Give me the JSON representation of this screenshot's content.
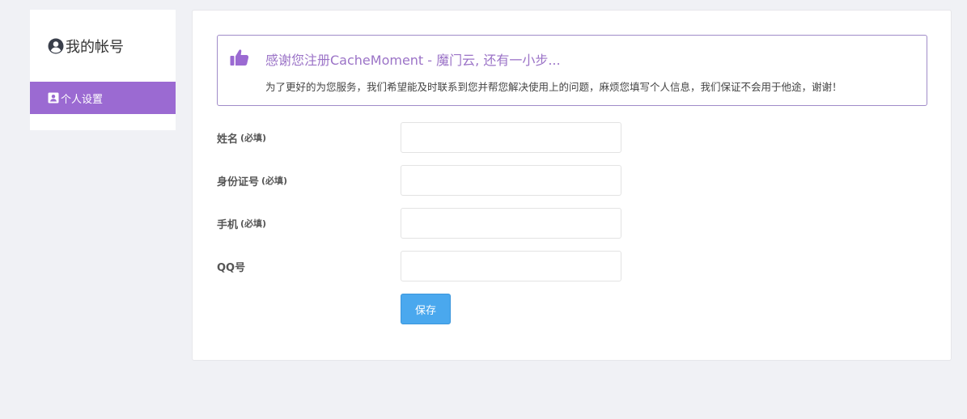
{
  "sidebar": {
    "title": "我的帐号",
    "title_icon": "user-circle-icon",
    "items": [
      {
        "label": "个人设置",
        "icon": "user-card-icon",
        "active": true
      }
    ]
  },
  "notice": {
    "icon": "thumbs-up-icon",
    "title": "感谢您注册CacheMoment - 魔门云, 还有一小步...",
    "description": "为了更好的为您服务，我们希望能及时联系到您并帮您解决使用上的问题，麻烦您填写个人信息，我们保证不会用于他途，谢谢！"
  },
  "form": {
    "fields": [
      {
        "label": "姓名",
        "required_note": "(必填)",
        "value": ""
      },
      {
        "label": "身份证号",
        "required_note": "(必填)",
        "value": ""
      },
      {
        "label": "手机",
        "required_note": "(必填)",
        "value": ""
      },
      {
        "label": "QQ号",
        "required_note": "",
        "value": ""
      }
    ],
    "save_label": "保存"
  },
  "colors": {
    "accent_purple": "#9b6ad2",
    "notice_border": "#a08bc8",
    "notice_title": "#9b73c7",
    "button_blue": "#4aa8ee",
    "page_bg": "#f0f1f5"
  }
}
